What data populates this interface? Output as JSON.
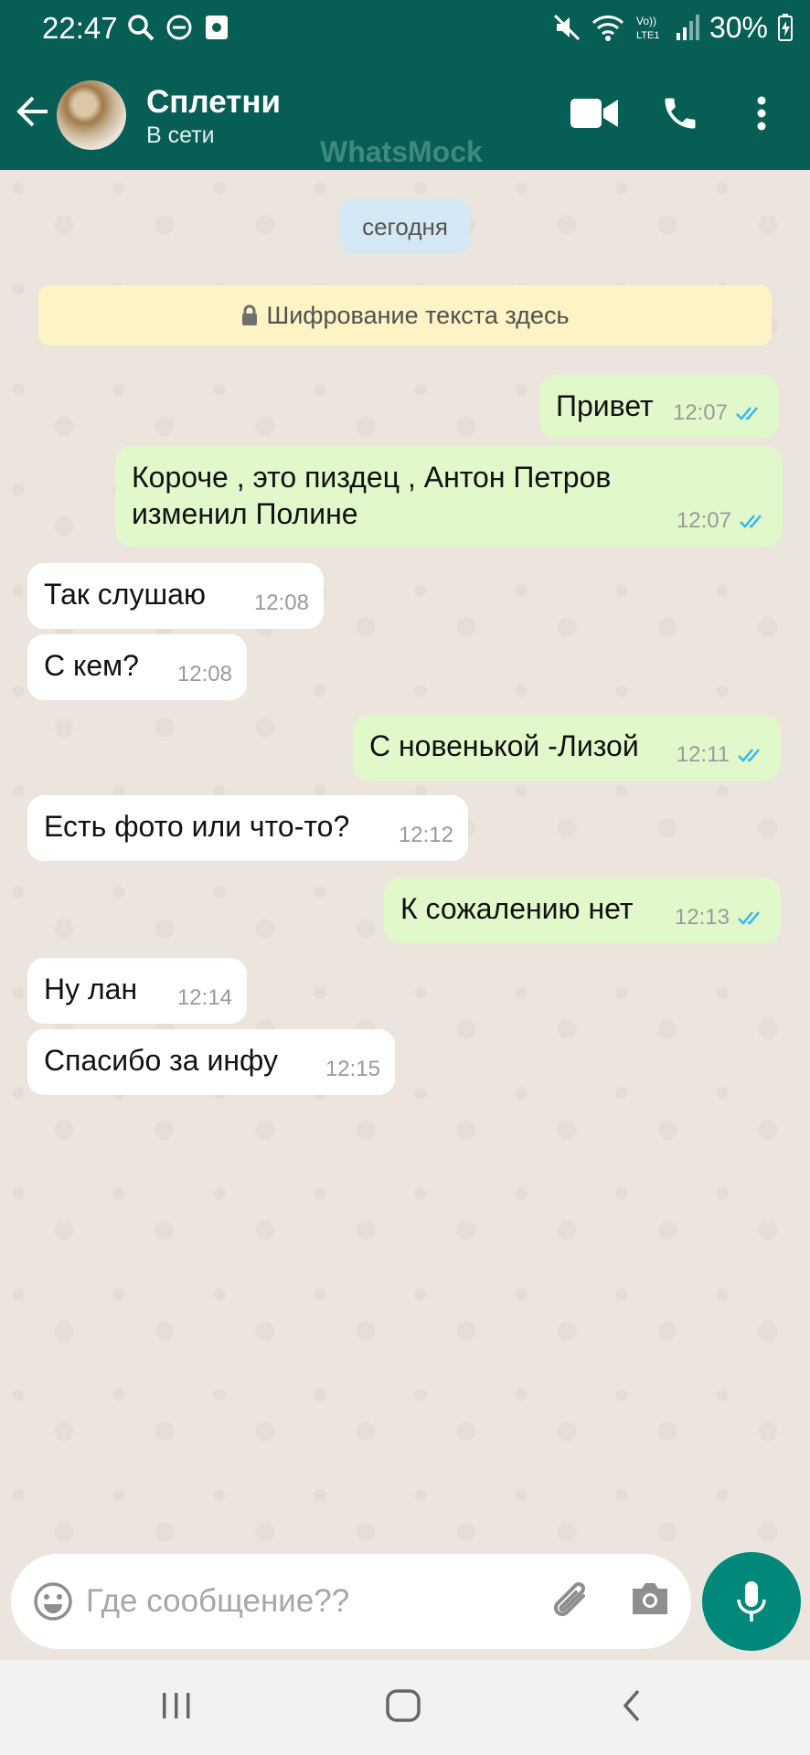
{
  "status_bar": {
    "time": "22:47",
    "battery": "30%"
  },
  "header": {
    "name": "Сплетни",
    "status": "В сети",
    "watermark": "WhatsMock"
  },
  "chat": {
    "date": "сегодня",
    "encryption": "Шифрование текста здесь",
    "messages": [
      {
        "direction": "out",
        "text": "Привет",
        "time": "12:07",
        "read": true
      },
      {
        "direction": "out",
        "text": "Короче , это пиздец , Антон Петров изменил Полине",
        "time": "12:07",
        "read": true
      },
      {
        "direction": "in",
        "text": "Так слушаю",
        "time": "12:08"
      },
      {
        "direction": "in",
        "text": "С кем?",
        "time": "12:08"
      },
      {
        "direction": "out",
        "text": "С новенькой -Лизой",
        "time": "12:11",
        "read": true
      },
      {
        "direction": "in",
        "text": "Есть фото или что-то?",
        "time": "12:12"
      },
      {
        "direction": "out",
        "text": "К сожалению нет",
        "time": "12:13",
        "read": true
      },
      {
        "direction": "in",
        "text": "Ну лан",
        "time": "12:14"
      },
      {
        "direction": "in",
        "text": "Спасибо за инфу",
        "time": "12:15"
      }
    ]
  },
  "composer": {
    "placeholder": "Где сообщение??"
  },
  "colors": {
    "header": "#075e54",
    "outgoing_bubble": "#e1f8cb",
    "read_ticks": "#34b7f1",
    "mic_button": "#00897b"
  }
}
